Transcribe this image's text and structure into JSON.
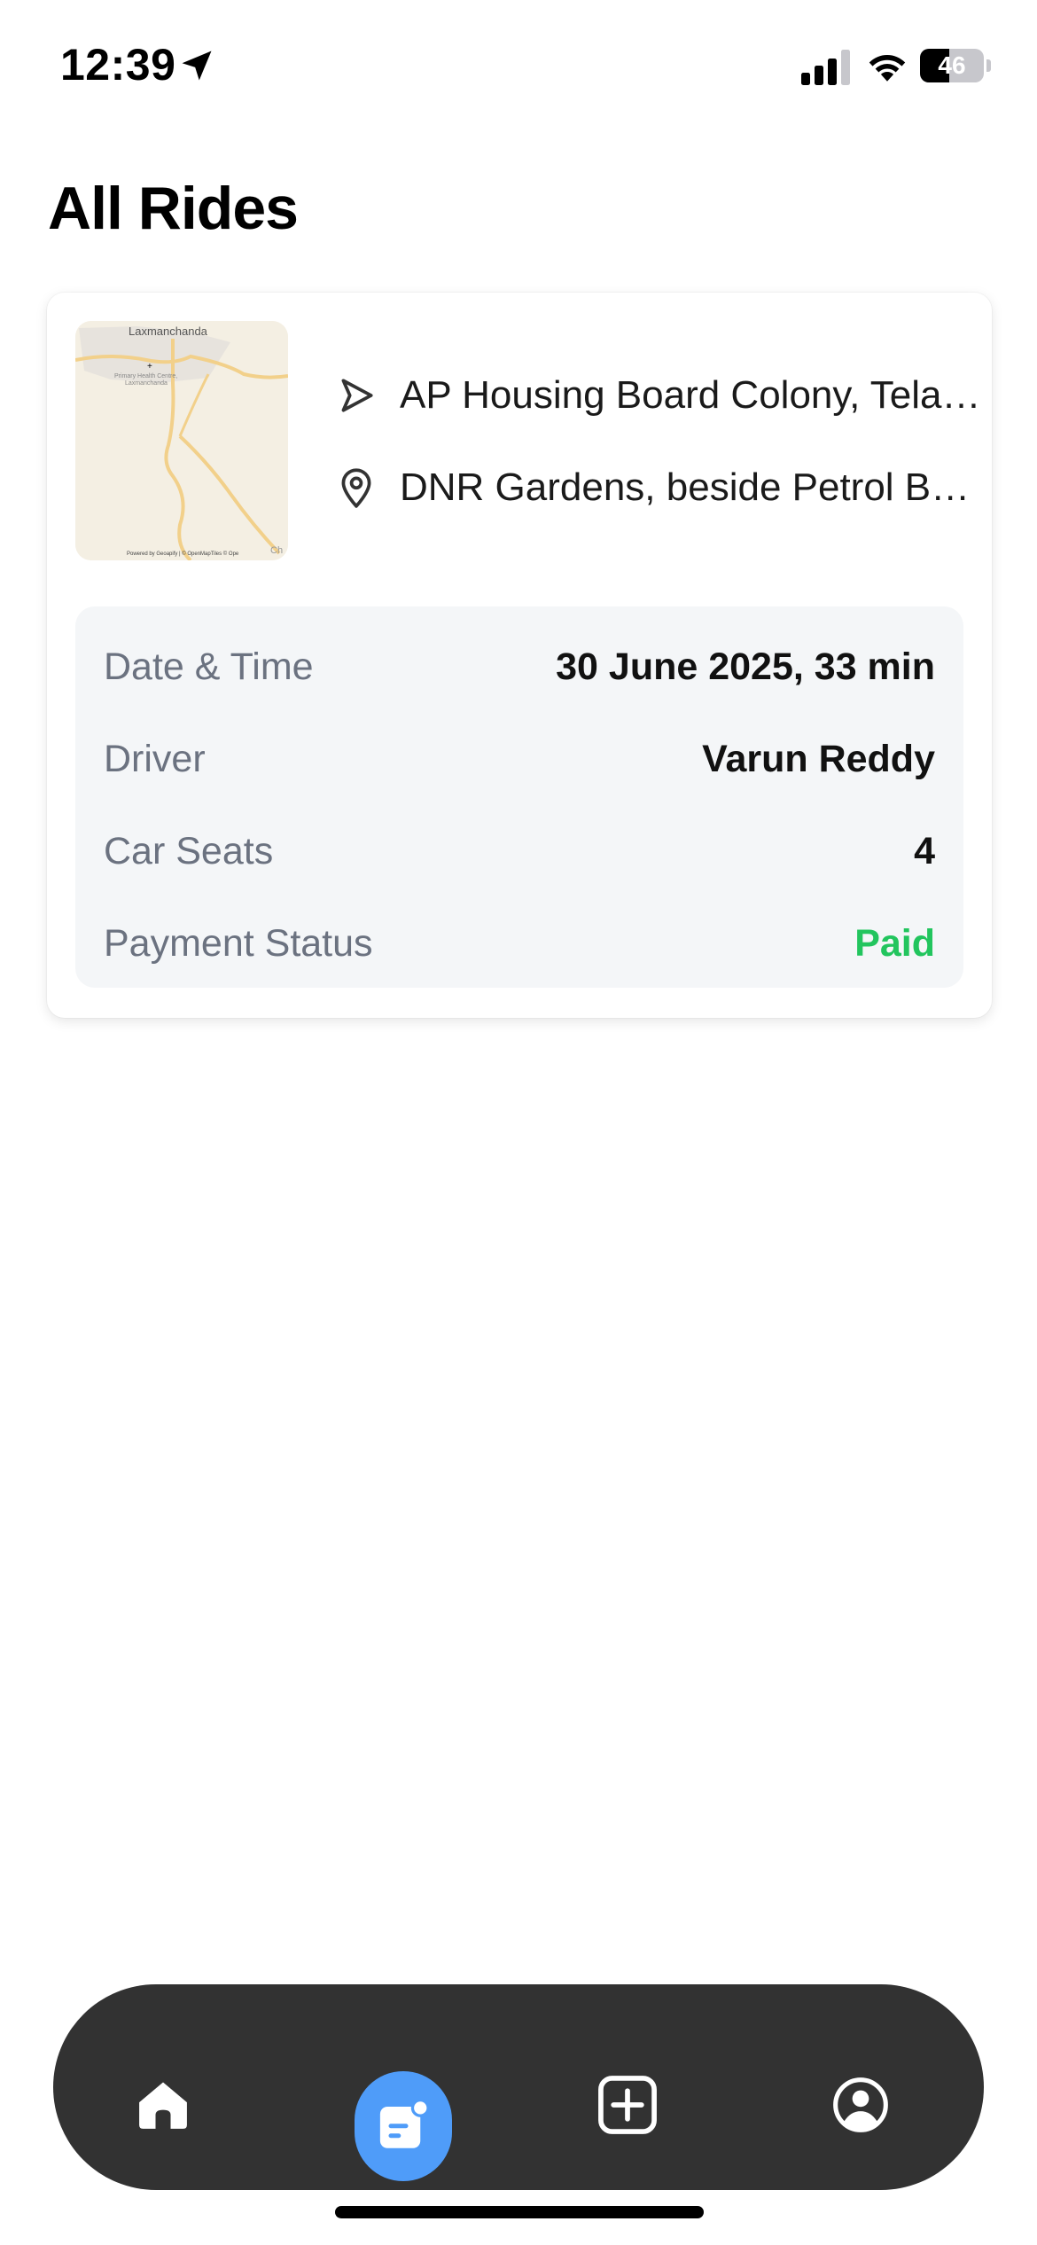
{
  "status_bar": {
    "time": "12:39",
    "battery_level": 46,
    "battery_label": "46",
    "icons": [
      "location-arrow-icon",
      "cellular-signal-icon",
      "wifi-icon",
      "battery-icon"
    ]
  },
  "page": {
    "title": "All Rides"
  },
  "rides": [
    {
      "map": {
        "place_label": "Laxmanchanda",
        "poi_label_line1": "Primary Health Centre,",
        "poi_label_line2": "Laxmanchanda",
        "attribution": "Powered by Geoapify | © OpenMapTiles © Ope",
        "corner_label": "Ch"
      },
      "pickup": "AP Housing Board Colony, Telangana",
      "dropoff": "DNR Gardens, beside Petrol Bunk",
      "details": {
        "date_time_label": "Date & Time",
        "date_time_value": "30 June 2025, 33 min",
        "driver_label": "Driver",
        "driver_value": "Varun Reddy",
        "seats_label": "Car Seats",
        "seats_value": "4",
        "payment_label": "Payment Status",
        "payment_value": "Paid"
      }
    }
  ],
  "colors": {
    "paid": "#22c55e",
    "nav_background": "#323232",
    "nav_active": "#4f9cf9"
  },
  "bottom_nav": {
    "items": [
      "home-icon",
      "rides-list-icon",
      "add-ride-icon",
      "profile-icon"
    ],
    "active": "rides-list-icon"
  }
}
